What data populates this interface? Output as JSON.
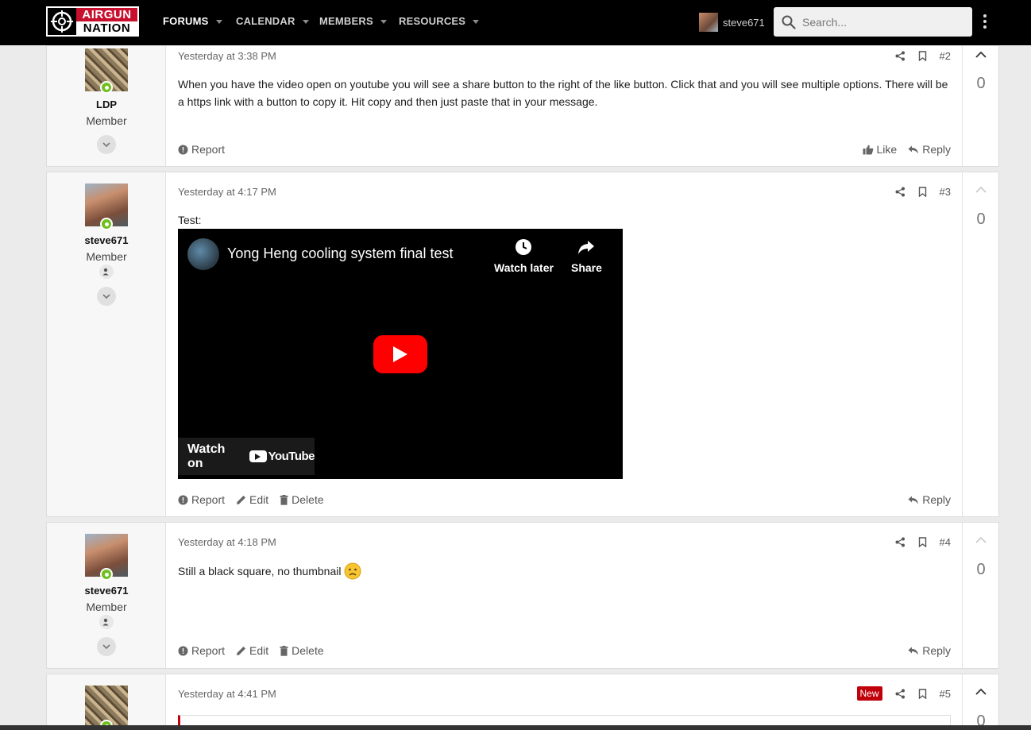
{
  "brand": {
    "line1": "AIRGUN",
    "line2": "NATION"
  },
  "nav": [
    {
      "label": "FORUMS",
      "active": true
    },
    {
      "label": "CALENDAR",
      "active": false
    },
    {
      "label": "MEMBERS",
      "active": false
    },
    {
      "label": "RESOURCES",
      "active": false
    }
  ],
  "account": {
    "username": "steve671"
  },
  "search": {
    "placeholder": "Search..."
  },
  "posts": [
    {
      "author": "LDP",
      "role": "Member",
      "date": "Yesterday at 3:38 PM",
      "number": "#2",
      "body": "When you have the video open on youtube you will see a share button to the right of the like button. Click that and you will see multiple options. There will be a https link with a button to copy it. Hit copy and then just paste that in your message.",
      "actions": {
        "report": "Report",
        "like": "Like",
        "reply": "Reply"
      },
      "votes": "0"
    },
    {
      "author": "steve671",
      "role": "Member",
      "date": "Yesterday at 4:17 PM",
      "number": "#3",
      "body": "Test:",
      "video": {
        "title": "Yong Heng cooling system final test",
        "watch_later": "Watch later",
        "share": "Share",
        "watch_on": "Watch on",
        "yt": "YouTube"
      },
      "actions": {
        "report": "Report",
        "edit": "Edit",
        "delete": "Delete",
        "reply": "Reply"
      },
      "votes": "0"
    },
    {
      "author": "steve671",
      "role": "Member",
      "date": "Yesterday at 4:18 PM",
      "number": "#4",
      "body": "Still a black square, no thumbnail",
      "actions": {
        "report": "Report",
        "edit": "Edit",
        "delete": "Delete",
        "reply": "Reply"
      },
      "votes": "0"
    },
    {
      "date": "Yesterday at 4:41 PM",
      "number": "#5",
      "badge": "New",
      "votes": "0"
    }
  ],
  "colors": {
    "accent": "#c0000a",
    "online": "#6fbf1f",
    "topbar": "#000000"
  }
}
